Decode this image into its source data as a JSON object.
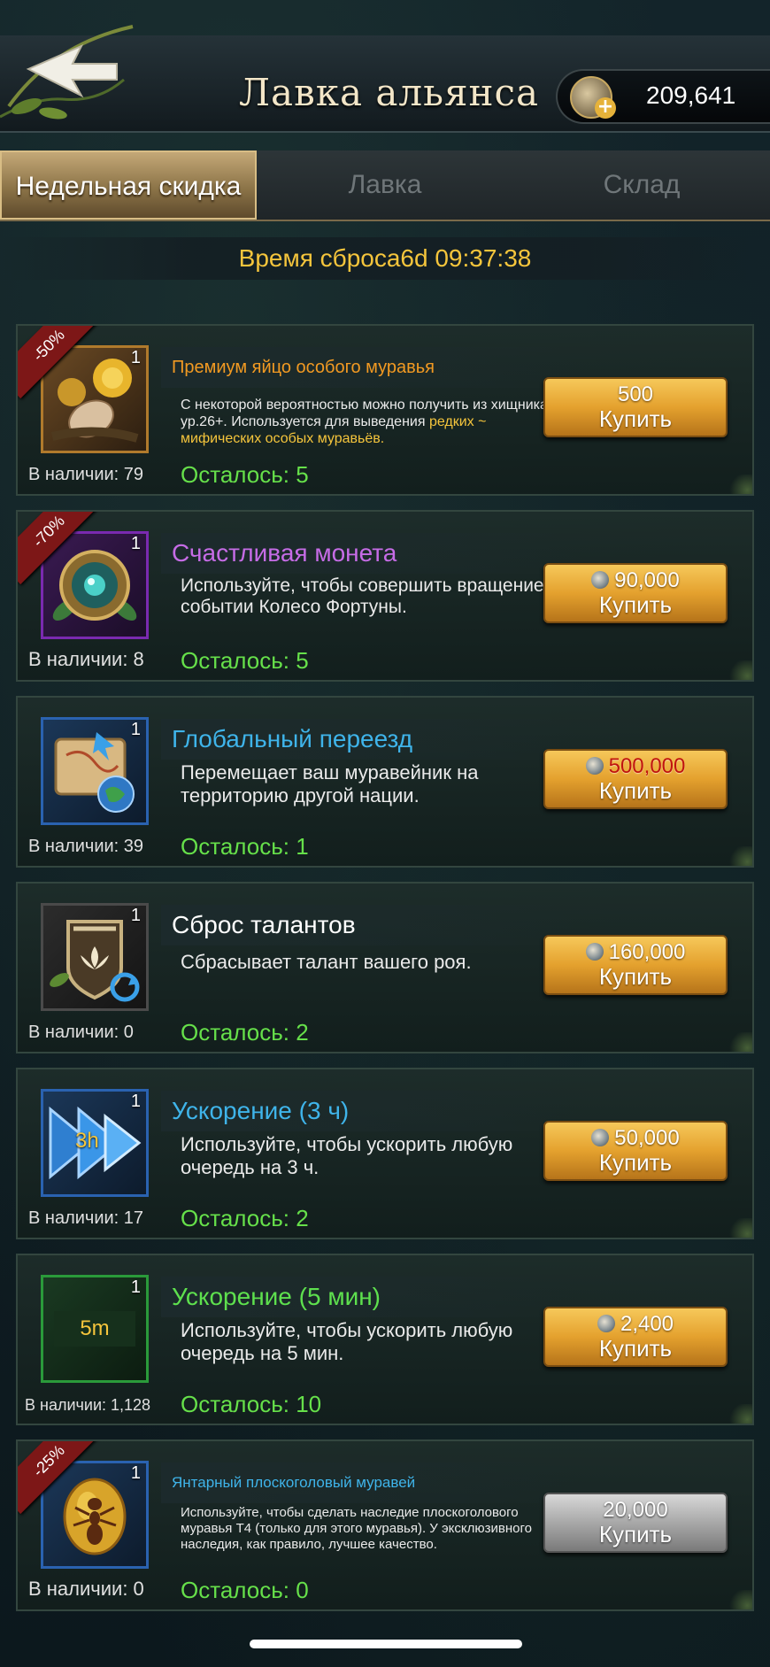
{
  "header": {
    "title": "Лавка альянса",
    "currency_value": "209,641"
  },
  "tabs": [
    {
      "label": "Недельная скидка",
      "active": true
    },
    {
      "label": "Лавка",
      "active": false
    },
    {
      "label": "Склад",
      "active": false
    }
  ],
  "timer": "Время сброса6d 09:37:38",
  "items": [
    {
      "discount": "-50%",
      "qty": "1",
      "title": "Премиум яйцо особого муравья",
      "title_color": "#f29a22",
      "desc_a": "С некоторой вероятностью можно получить из хищника ур.26+. Используется для выведения",
      "desc_b": "редких ~ мифических особых муравьёв.",
      "stock": "В наличии: 79",
      "remaining": "Осталось: 5",
      "price": "500",
      "buy": "Купить"
    },
    {
      "discount": "-70%",
      "qty": "1",
      "title": "Счастливая монета",
      "title_color": "#c66ce6",
      "desc": "Используйте, чтобы совершить вращение в событии Колесо Фортуны.",
      "stock": "В наличии: 8",
      "remaining": "Осталось: 5",
      "price": "90,000",
      "buy": "Купить"
    },
    {
      "qty": "1",
      "title": "Глобальный переезд",
      "title_color": "#3fb4ea",
      "desc": "Перемещает ваш муравейник на территорию другой нации.",
      "stock": "В наличии: 39",
      "remaining": "Осталось: 1",
      "price": "500,000",
      "buy": "Купить"
    },
    {
      "qty": "1",
      "title": "Сброс талантов",
      "title_color": "#ffffff",
      "desc": "Сбрасывает талант вашего роя.",
      "stock": "В наличии: 0",
      "remaining": "Осталось: 2",
      "price": "160,000",
      "buy": "Купить"
    },
    {
      "qty": "1",
      "icon_text": "3h",
      "title": "Ускорение (3 ч)",
      "title_color": "#3fb4ea",
      "desc": "Используйте, чтобы ускорить любую очередь на 3 ч.",
      "stock": "В наличии: 17",
      "remaining": "Осталось: 2",
      "price": "50,000",
      "buy": "Купить"
    },
    {
      "qty": "1",
      "icon_text": "5m",
      "title": "Ускорение (5 мин)",
      "title_color": "#5ee04e",
      "desc": "Используйте, чтобы ускорить любую очередь на 5 мин.",
      "stock": "В наличии: 1,128",
      "remaining": "Осталось: 10",
      "price": "2,400",
      "buy": "Купить"
    },
    {
      "discount": "-25%",
      "qty": "1",
      "title": "Янтарный плоскоголовый муравей",
      "title_color": "#3fb4ea",
      "desc": "Используйте, чтобы сделать наследие плоскоголового муравья Т4 (только для этого муравья). У эксклюзивного наследия, как правило, лучшее качество.",
      "stock": "В наличии: 0",
      "remaining": "Осталось: 0",
      "price": "20,000",
      "buy": "Купить"
    }
  ],
  "colors": {
    "gold_button": "#e4a12e",
    "remaining_green": "#66e04a",
    "timer_yellow": "#f5c53c",
    "price_red": "#c0140e"
  },
  "icons": [
    "back-arrow-icon",
    "coin-plus-icon",
    "egg-icon",
    "lucky-coin-icon",
    "map-globe-icon",
    "talent-reset-icon",
    "speedup-icon",
    "coin-icon",
    "amber-ant-icon"
  ]
}
